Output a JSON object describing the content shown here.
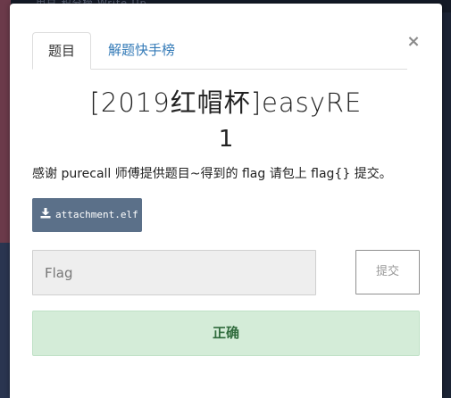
{
  "backdrop": {
    "topbar_text": "用户   积分榜   Write Up"
  },
  "modal": {
    "close_glyph": "×",
    "tabs": [
      {
        "label": "题目",
        "active": true
      },
      {
        "label": "解题快手榜",
        "active": false
      }
    ],
    "title": "[2019红帽杯]easyRE",
    "value": "1",
    "description": "感谢 purecall 师傅提供题目~得到的 flag 请包上 flag{} 提交。",
    "attachment": {
      "label": "attachment.elf",
      "icon": "download-icon"
    },
    "flag_input": {
      "placeholder": "Flag",
      "value": ""
    },
    "submit_label": "提交",
    "result_text": "正确"
  },
  "colors": {
    "tab_link": "#337ab7",
    "attachment_bg": "#5b7089",
    "input_bg": "#eeeeee",
    "success_bg": "#d4ecd8",
    "success_text": "#2f6b3c"
  }
}
